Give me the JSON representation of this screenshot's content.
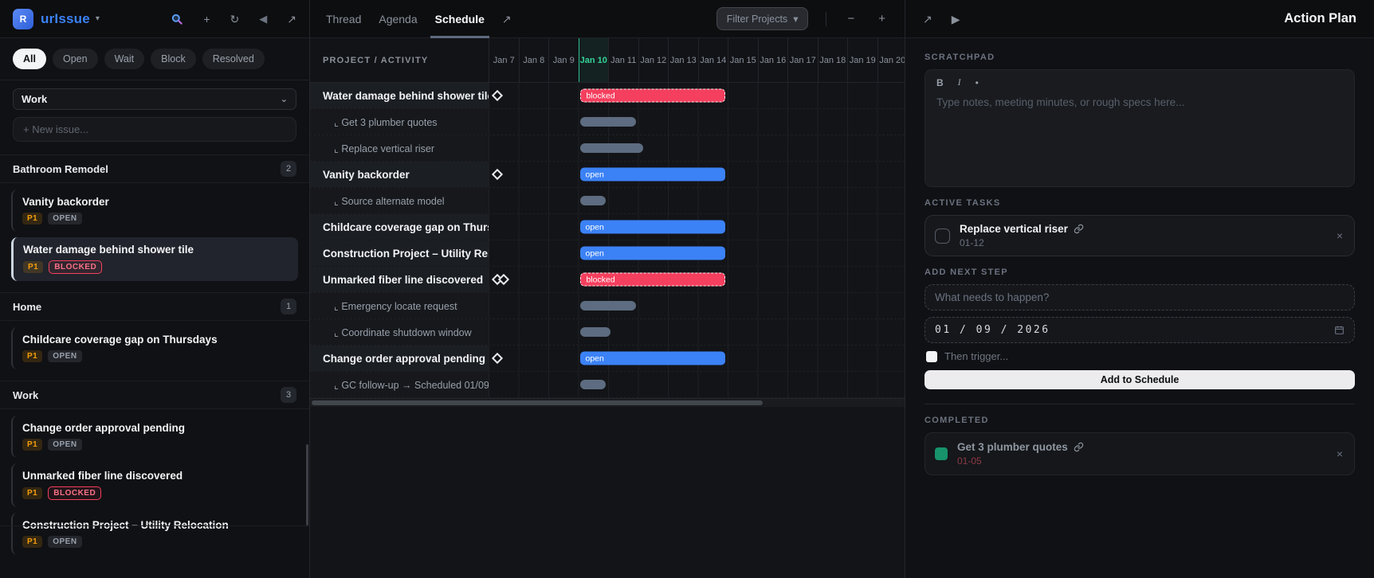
{
  "brand": {
    "badge_letter": "R",
    "name": "urIssue",
    "caret": "▾"
  },
  "sidebar": {
    "icons": {
      "plus": "+",
      "refresh": "↻",
      "back": "◀",
      "expand": "↗"
    },
    "filters": [
      {
        "label": "All"
      },
      {
        "label": "Open"
      },
      {
        "label": "Wait"
      },
      {
        "label": "Block"
      },
      {
        "label": "Resolved"
      }
    ],
    "project_select": {
      "value": "Work",
      "caret": "⌄"
    },
    "new_issue_placeholder": "+ New issue...",
    "groups": [
      {
        "name": "Bathroom Remodel",
        "count": "2",
        "items": [
          {
            "title": "Vanity backorder",
            "priority": "P1",
            "status": "OPEN"
          },
          {
            "title": "Water damage behind shower tile",
            "priority": "P1",
            "status": "BLOCKED"
          }
        ]
      },
      {
        "name": "Home",
        "count": "1",
        "items": [
          {
            "title": "Childcare coverage gap on Thursdays",
            "priority": "P1",
            "status": "OPEN"
          }
        ]
      },
      {
        "name": "Work",
        "count": "3",
        "items": [
          {
            "title": "Change order approval pending",
            "priority": "P1",
            "status": "OPEN"
          },
          {
            "title": "Unmarked fiber line discovered",
            "priority": "P1",
            "status": "BLOCKED"
          },
          {
            "title": "Construction Project – Utility Relocation",
            "priority": "P1",
            "status": "OPEN"
          }
        ]
      }
    ]
  },
  "schedule": {
    "tabs": [
      {
        "label": "Thread"
      },
      {
        "label": "Agenda"
      },
      {
        "label": "Schedule"
      }
    ],
    "expand_icon": "↗",
    "filter_button": {
      "label": "Filter Projects",
      "caret": "▾"
    },
    "zoom_out": "−",
    "zoom_in": "+",
    "header_label": "PROJECT / ACTIVITY",
    "today": "Jan 10",
    "dates": [
      {
        "label": "Jan 7"
      },
      {
        "label": "Jan 8"
      },
      {
        "label": "Jan 9"
      },
      {
        "label": "Jan 10"
      },
      {
        "label": "Jan 11"
      },
      {
        "label": "Jan 12"
      },
      {
        "label": "Jan 13"
      },
      {
        "label": "Jan 14"
      },
      {
        "label": "Jan 15"
      },
      {
        "label": "Jan 16"
      },
      {
        "label": "Jan 17"
      },
      {
        "label": "Jan 18"
      },
      {
        "label": "Jan 19"
      },
      {
        "label": "Jan 20"
      }
    ],
    "rows": [
      {
        "label": "Water damage behind shower tile",
        "kind": "parent",
        "marker": "diamond",
        "bar": {
          "type": "blocked",
          "label": "blocked",
          "start": 3,
          "span": 5
        }
      },
      {
        "label": "⌞ Get 3 plumber quotes",
        "kind": "sub",
        "bar": {
          "type": "sub",
          "start": 3,
          "span": 2
        }
      },
      {
        "label": "⌞ Replace vertical riser",
        "kind": "sub",
        "bar": {
          "type": "sub",
          "start": 3,
          "span": 2.25
        }
      },
      {
        "label": "Vanity backorder",
        "kind": "parent",
        "marker": "diamond",
        "bar": {
          "type": "open",
          "label": "open",
          "start": 3,
          "span": 5
        }
      },
      {
        "label": "⌞ Source alternate model",
        "kind": "sub",
        "bar": {
          "type": "sub",
          "start": 3,
          "span": 1
        }
      },
      {
        "label": "Childcare coverage gap on Thursdays",
        "kind": "parent",
        "marker": "none",
        "bar": {
          "type": "open",
          "label": "open",
          "start": 3,
          "span": 5
        }
      },
      {
        "label": "Construction Project – Utility Relocation",
        "kind": "parent",
        "marker": "none",
        "bar": {
          "type": "open",
          "label": "open",
          "start": 3,
          "span": 5
        }
      },
      {
        "label": "Unmarked fiber line discovered",
        "kind": "parent",
        "marker": "double-diamond",
        "bar": {
          "type": "blocked",
          "label": "blocked",
          "start": 3,
          "span": 5
        }
      },
      {
        "label": "⌞ Emergency locate request",
        "kind": "sub",
        "bar": {
          "type": "sub",
          "start": 3,
          "span": 2
        }
      },
      {
        "label": "⌞ Coordinate shutdown window",
        "kind": "sub",
        "bar": {
          "type": "sub",
          "start": 3,
          "span": 1.15
        }
      },
      {
        "label": "Change order approval pending",
        "kind": "parent",
        "marker": "diamond",
        "bar": {
          "type": "open",
          "label": "open",
          "start": 3,
          "span": 5
        }
      },
      {
        "label": "⌞ GC follow-up → Scheduled 01/09",
        "kind": "sub",
        "bar": {
          "type": "sub",
          "start": 3,
          "span": 1
        }
      }
    ]
  },
  "action_plan": {
    "expand_icon": "↗",
    "run_icon": "▶",
    "title": "Action Plan",
    "scratchpad": {
      "label": "SCRATCHPAD",
      "bold": "B",
      "italic": "I",
      "bullet": "•",
      "placeholder": "Type notes, meeting minutes, or rough specs here..."
    },
    "active_tasks": {
      "label": "ACTIVE TASKS",
      "items": [
        {
          "title": "Replace vertical riser",
          "date": "01-12",
          "close": "×"
        }
      ]
    },
    "add_next_step": {
      "label": "ADD NEXT STEP",
      "what_placeholder": "What needs to happen?",
      "date_value": "01 / 09 / 2026",
      "trigger_label": "Then trigger...",
      "submit_label": "Add to Schedule"
    },
    "completed": {
      "label": "COMPLETED",
      "items": [
        {
          "title": "Get 3 plumber quotes",
          "date": "01-05",
          "close": "×"
        }
      ]
    }
  }
}
